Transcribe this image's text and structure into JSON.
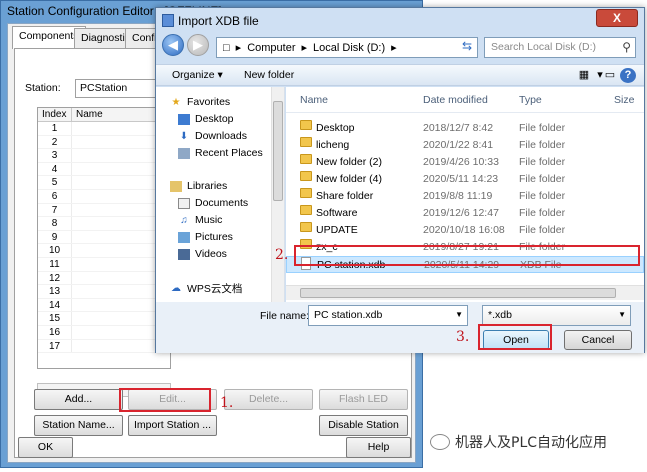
{
  "sce": {
    "title": "Station Configuration Editor - [OFFLINE]",
    "tabs": [
      "Components",
      "Diagnostics",
      "Config"
    ],
    "station_label": "Station:",
    "station_value": "PCStation",
    "table_headers": [
      "Index",
      "Name"
    ],
    "rows": [
      "1",
      "2",
      "3",
      "4",
      "5",
      "6",
      "7",
      "8",
      "9",
      "10",
      "11",
      "12",
      "13",
      "14",
      "15",
      "16",
      "17"
    ],
    "buttons": {
      "add": "Add...",
      "edit": "Edit...",
      "delete": "Delete...",
      "flash_led": "Flash LED",
      "station_name": "Station Name...",
      "import_station": "Import Station ...",
      "disable_station": "Disable Station",
      "ok": "OK",
      "help": "Help"
    }
  },
  "steps": {
    "s1": "1.",
    "s2": "2.",
    "s3": "3."
  },
  "dialog": {
    "title": "Import XDB file",
    "close": "X",
    "address": {
      "root": "Computer",
      "drive": "Local Disk (D:)"
    },
    "search_placeholder": "Search Local Disk (D:)",
    "toolbar": {
      "organize": "Organize",
      "new_folder": "New folder"
    },
    "nav": {
      "favorites": "Favorites",
      "favorites_items": [
        "Desktop",
        "Downloads",
        "Recent Places"
      ],
      "libraries": "Libraries",
      "libraries_items": [
        "Documents",
        "Music",
        "Pictures",
        "Videos"
      ],
      "wps": "WPS云文档"
    },
    "columns": {
      "name": "Name",
      "date": "Date modified",
      "type": "Type",
      "size": "Size"
    },
    "files": [
      {
        "name": "Desktop",
        "date": "2018/12/7 8:42",
        "type": "File folder"
      },
      {
        "name": "licheng",
        "date": "2020/1/22 8:41",
        "type": "File folder"
      },
      {
        "name": "New folder (2)",
        "date": "2019/4/26 10:33",
        "type": "File folder"
      },
      {
        "name": "New folder (4)",
        "date": "2020/5/11 14:23",
        "type": "File folder"
      },
      {
        "name": "Share folder",
        "date": "2019/8/8 11:19",
        "type": "File folder"
      },
      {
        "name": "Software",
        "date": "2019/12/6 12:47",
        "type": "File folder"
      },
      {
        "name": "UPDATE",
        "date": "2020/10/18 16:08",
        "type": "File folder"
      },
      {
        "name": "zx_c",
        "date": "2019/8/27 19:21",
        "type": "File folder"
      },
      {
        "name": "PC station.xdb",
        "date": "2020/5/11 14:29",
        "type": "XDB File"
      }
    ],
    "file_name_label": "File name:",
    "file_name_value": "PC station.xdb",
    "filter_value": "*.xdb",
    "open": "Open",
    "cancel": "Cancel"
  },
  "watermark": "机器人及PLC自动化应用",
  "colors": {
    "highlight": "#d9242e",
    "selection": "#cce8ff",
    "title_bar": "#6aa0d4"
  }
}
